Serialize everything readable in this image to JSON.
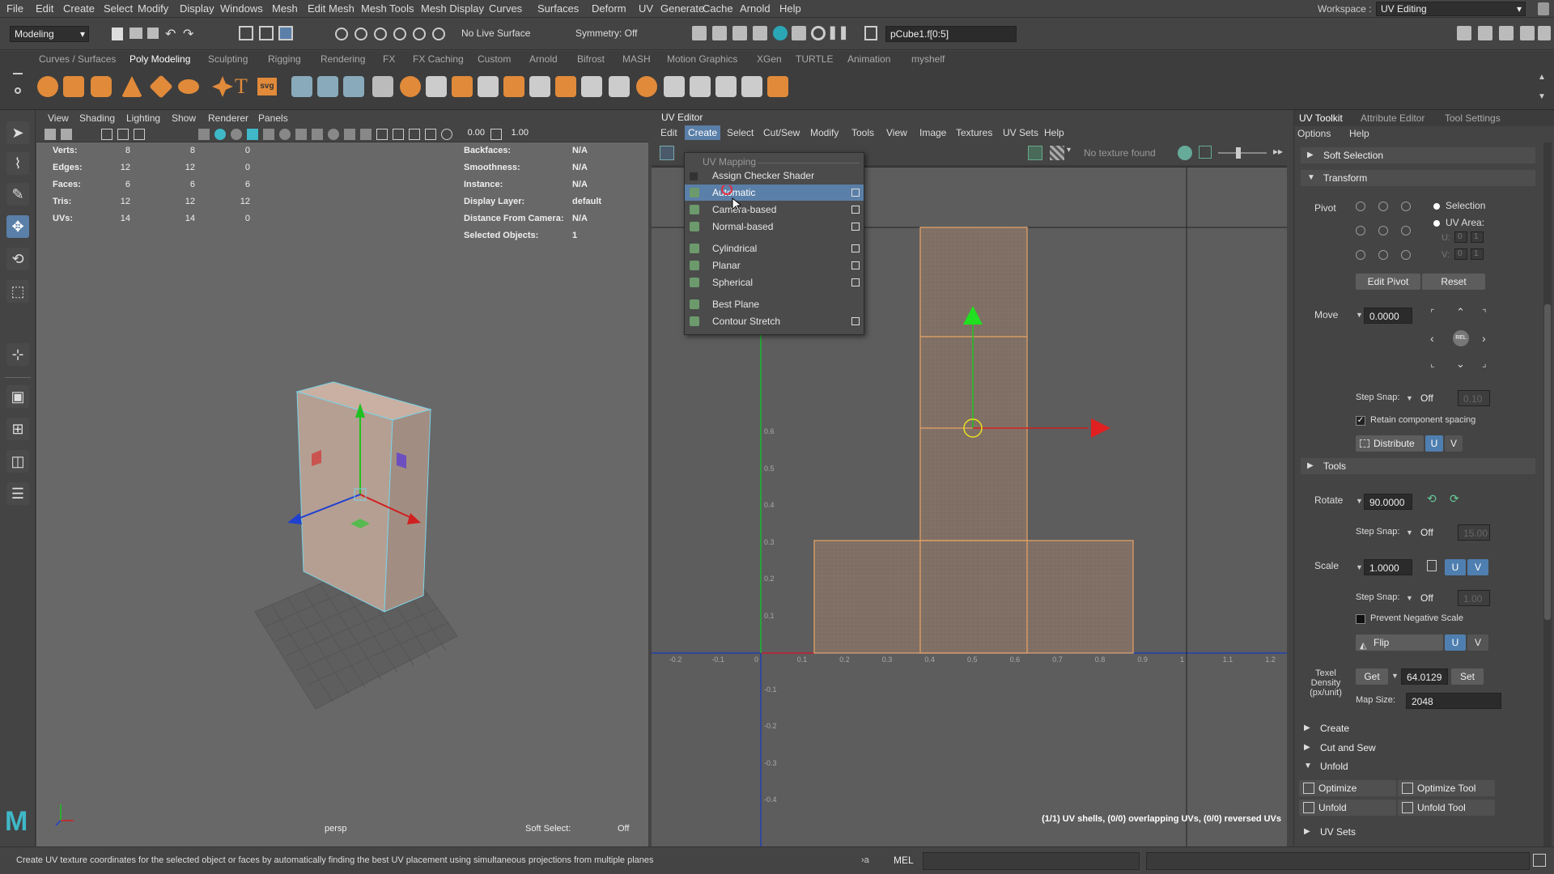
{
  "menubar": {
    "items": [
      "File",
      "Edit",
      "Create",
      "Select",
      "Modify",
      "Display",
      "Windows",
      "Mesh",
      "Edit Mesh",
      "Mesh Tools",
      "Mesh Display",
      "Curves",
      "Surfaces",
      "Deform",
      "UV",
      "Generate",
      "Cache",
      "Arnold",
      "Help"
    ],
    "workspace_label": "Workspace :",
    "workspace_value": "UV Editing"
  },
  "statusline": {
    "mode": "Modeling",
    "live_surface": "No Live Surface",
    "symmetry": "Symmetry: Off",
    "selection_field": "pCube1.f[0:5]"
  },
  "shelf": {
    "tabs": [
      "Curves / Surfaces",
      "Poly Modeling",
      "Sculpting",
      "Rigging",
      "Rendering",
      "FX",
      "FX Caching",
      "Custom",
      "Arnold",
      "Bifrost",
      "MASH",
      "Motion Graphics",
      "XGen",
      "TURTLE",
      "Animation",
      "myshelf"
    ],
    "active_tab": "Poly Modeling",
    "svg_icon_label": "svg"
  },
  "viewport": {
    "menu": [
      "View",
      "Shading",
      "Lighting",
      "Show",
      "Renderer",
      "Panels"
    ],
    "exposure": "0.00",
    "gamma": "1.00",
    "hud_left": [
      {
        "label": "Verts:",
        "v1": "8",
        "v2": "8",
        "v3": "0"
      },
      {
        "label": "Edges:",
        "v1": "12",
        "v2": "12",
        "v3": "0"
      },
      {
        "label": "Faces:",
        "v1": "6",
        "v2": "6",
        "v3": "6"
      },
      {
        "label": "Tris:",
        "v1": "12",
        "v2": "12",
        "v3": "12"
      },
      {
        "label": "UVs:",
        "v1": "14",
        "v2": "14",
        "v3": "0"
      }
    ],
    "hud_right": [
      {
        "label": "Backfaces:",
        "value": "N/A"
      },
      {
        "label": "Smoothness:",
        "value": "N/A"
      },
      {
        "label": "Instance:",
        "value": "N/A"
      },
      {
        "label": "Display Layer:",
        "value": "default"
      },
      {
        "label": "Distance From Camera:",
        "value": "N/A"
      },
      {
        "label": "Selected Objects:",
        "value": "1"
      }
    ],
    "camera": "persp",
    "soft_select_label": "Soft Select:",
    "soft_select_value": "Off"
  },
  "uv_editor": {
    "title": "UV Editor",
    "menu": [
      "Edit",
      "Create",
      "Select",
      "Cut/Sew",
      "Modify",
      "Tools",
      "View",
      "Image",
      "Textures",
      "UV Sets",
      "Help"
    ],
    "active_menu": "Create",
    "no_texture": "No texture found",
    "status": "(1/1) UV shells, (0/0) overlapping UVs, (0/0) reversed UVs",
    "ticks_x": [
      "-0.2",
      "-0.1",
      "0",
      "0.1",
      "0.2",
      "0.3",
      "0.4",
      "0.5",
      "0.6",
      "0.7",
      "0.8",
      "0.9",
      "1",
      "1.1",
      "1.2"
    ],
    "ticks_y": [
      "0.6",
      "0.5",
      "0.4",
      "0.3",
      "0.2",
      "0.1",
      "-0.1",
      "-0.2",
      "-0.3",
      "-0.4"
    ]
  },
  "dropdown": {
    "header": "UV Mapping",
    "items": [
      {
        "label": "Assign Checker Shader",
        "box": false,
        "icon": false
      },
      {
        "label": "Automatic",
        "box": true,
        "icon": true,
        "highlight": true
      },
      {
        "label": "Camera-based",
        "box": true,
        "icon": true
      },
      {
        "label": "Normal-based",
        "box": true,
        "icon": true
      },
      {
        "label": "Cylindrical",
        "box": true,
        "icon": true
      },
      {
        "label": "Planar",
        "box": true,
        "icon": true
      },
      {
        "label": "Spherical",
        "box": true,
        "icon": true
      },
      {
        "label": "Best Plane",
        "box": false,
        "icon": true
      },
      {
        "label": "Contour Stretch",
        "box": true,
        "icon": true
      }
    ]
  },
  "right_panel": {
    "tabs": [
      "UV Toolkit",
      "Attribute Editor",
      "Tool Settings"
    ],
    "active_tab": "UV Toolkit",
    "submenu": [
      "Options",
      "Help"
    ],
    "soft_selection": "Soft Selection",
    "transform": "Transform",
    "pivot_label": "Pivot",
    "pivot_selection": "Selection",
    "pivot_uv_area": "UV Area:",
    "pivot_u_label": "U:",
    "pivot_v_label": "V:",
    "pivot_u_value": "0",
    "pivot_v_value": "0",
    "pivot_u2": "1",
    "pivot_v2": "1",
    "edit_pivot": "Edit Pivot",
    "reset": "Reset",
    "move_label": "Move",
    "move_value": "0.0000",
    "move_center": "REL",
    "step_snap_label": "Step Snap:",
    "step_snap_off": "Off",
    "move_step": "0.10",
    "retain_spacing": "Retain component spacing",
    "distribute": "Distribute",
    "u": "U",
    "v": "V",
    "tools": "Tools",
    "rotate_label": "Rotate",
    "rotate_value": "90.0000",
    "rotate_step": "15.00",
    "scale_label": "Scale",
    "scale_value": "1.0000",
    "scale_step": "1.00",
    "prevent_negative": "Prevent Negative Scale",
    "flip": "Flip",
    "texel_label": "Texel\nDensity\n(px/unit)",
    "get": "Get",
    "texel_value": "64.0129",
    "set": "Set",
    "map_size_label": "Map Size:",
    "map_size_value": "2048",
    "create": "Create",
    "cut_and_sew": "Cut and Sew",
    "unfold": "Unfold",
    "optimize": "Optimize",
    "optimize_tool": "Optimize Tool",
    "unfold_btn": "Unfold",
    "unfold_tool": "Unfold Tool",
    "uv_sets": "UV Sets"
  },
  "statusbar": {
    "help": "Create UV texture coordinates for the selected object or faces by automatically finding the best UV placement using simultaneous projections from multiple planes",
    "mel": "MEL"
  },
  "colors": {
    "accent": "#5a7fa8",
    "uv_shell_border": "#e8a566",
    "uv_shell_fill": "#7f6e63",
    "u_axis": "#d02020",
    "v_axis": "#20c020"
  }
}
